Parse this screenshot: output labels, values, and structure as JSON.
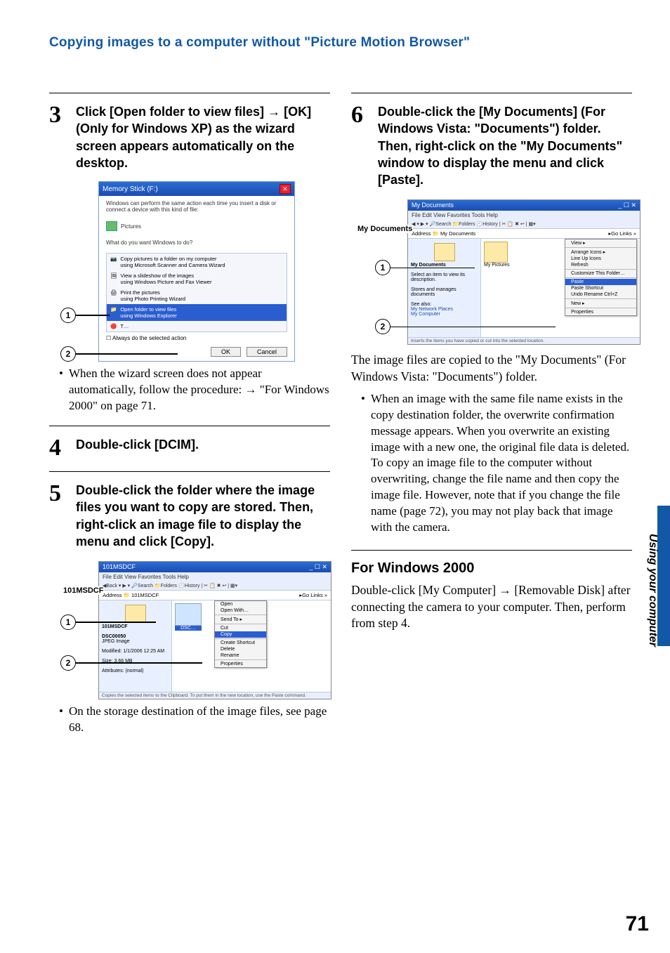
{
  "header": {
    "title": "Copying images to a computer without \"Picture Motion Browser\""
  },
  "steps": {
    "s3": {
      "num": "3",
      "text_a": "Click [Open folder to view files] ",
      "text_b": " [OK](Only for Windows XP) as the wizard screen appears automatically on the desktop."
    },
    "s4": {
      "num": "4",
      "text": "Double-click [DCIM]."
    },
    "s5": {
      "num": "5",
      "text": "Double-click the folder where the image files you want to copy are stored. Then, right-click an image file to display the menu and click [Copy]."
    },
    "s6": {
      "num": "6",
      "text": "Double-click the [My Documents] (For Windows Vista: \"Documents\") folder. Then, right-click on the \"My Documents\" window to display the menu and click [Paste]."
    }
  },
  "bullets": {
    "b3": "When the wizard screen does not appear automatically, follow the procedure: ",
    "b3b": " \"For Windows 2000\" on page 71.",
    "b5": "On the storage destination of the image files, see page 68.",
    "b6_body": "The image files are copied to the \"My Documents\" (For Windows Vista: \"Documents\") folder.",
    "b6_bullet": "When an image with the same file name exists in the copy destination folder, the overwrite confirmation message appears. When you overwrite an existing image with a new one, the original file data is deleted. To copy an image file to the computer without overwriting, change the file name and then copy the image file. However, note that if you change the file name (page 72), you may not play back that image with the camera."
  },
  "win2000": {
    "heading": "For Windows 2000",
    "body_a": "Double-click [My Computer] ",
    "body_b": " [Removable Disk] after connecting the camera to your computer. Then, perform from step 4."
  },
  "sidebar": {
    "label": "Using your computer"
  },
  "page": {
    "num": "71"
  },
  "callouts": {
    "c1": "1",
    "c2": "2"
  },
  "shot_wizard": {
    "title": "Memory Stick (F:)",
    "intro": "Windows can perform the same action each time you insert a disk or connect a device with this kind of file:",
    "pictures": "Pictures",
    "prompt": "What do you want Windows to do?",
    "items": [
      "Copy pictures to a folder on my computer\nusing Microsoft Scanner and Camera Wizard",
      "View a slideshow of the images\nusing Windows Picture and Fax Viewer",
      "Print the pictures\nusing Photo Printing Wizard",
      "Open folder to view files\nusing Windows Explorer"
    ],
    "always": "Always do the selected action",
    "ok": "OK",
    "cancel": "Cancel"
  },
  "shot_101": {
    "title": "101MSDCF",
    "label": "101MSDCF",
    "menus": "File   Edit   View   Favorites   Tools   Help",
    "toolbar": "◀Back ▾ ▶ ▾ 🔎Search  📁Folders  🕘History  | ✂ 📋 ✖ ↩ | ▦▾",
    "address": "Address  📁 101MSDCF",
    "go": "▸Go   Links »",
    "side_title": "101MSDCF",
    "side_file": "DSC00050",
    "side_type": "JPEG Image",
    "side_mod": "Modified: 1/1/2006 12:25 AM",
    "side_size": "Size: 3.66 MB",
    "side_attr": "Attributes: (normal)",
    "ctx": [
      "Open",
      "Open With…",
      "—",
      "Send To      ▸",
      "—",
      "Cut",
      "Copy",
      "—",
      "Create Shortcut",
      "Delete",
      "Rename",
      "—",
      "Properties"
    ],
    "status": "Copies the selected items to the Clipboard. To put them in the new location, use the Paste command."
  },
  "shot_mydocs": {
    "title": "My Documents",
    "label": "My Documents",
    "menus": "File   Edit   View   Favorites   Tools   Help",
    "toolbar": "◀ ▾ ▶ ▾ 🔎Search  📁Folders  🕘History  | ✂ 📋 ✖ ↩ | ▦▾",
    "address": "Address  📁 My Documents",
    "go": "▸Go   Links »",
    "thumb_label": "My Pictures",
    "side_title": "My Documents",
    "side_hint1": "Select an item to view its description.",
    "side_hint2": "Stores and manages documents",
    "side_seealso": "See also:",
    "side_link1": "My Network Places",
    "side_link2": "My Computer",
    "ctx": [
      "View                       ▸",
      "—",
      "Arrange Icons        ▸",
      "Line Up Icons",
      "Refresh",
      "—",
      "Customize This Folder…",
      "—",
      "Paste",
      "Paste Shortcut",
      "Undo Rename      Ctrl+Z",
      "—",
      "New                        ▸",
      "—",
      "Properties"
    ],
    "status": "Inserts the items you have copied or cut into the selected location."
  }
}
